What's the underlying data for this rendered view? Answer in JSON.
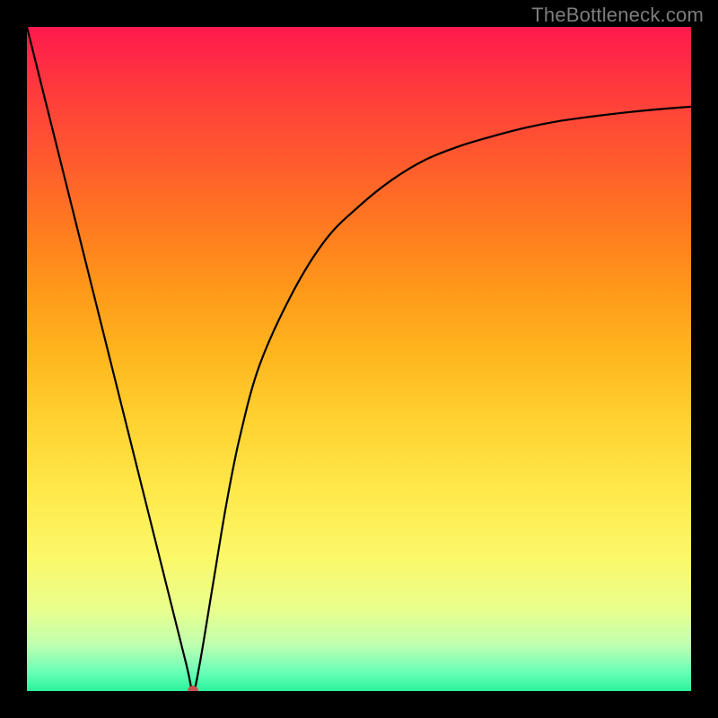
{
  "watermark": "TheBottleneck.com",
  "chart_data": {
    "type": "line",
    "title": "",
    "xlabel": "",
    "ylabel": "",
    "xlim": [
      0,
      100
    ],
    "ylim": [
      0,
      100
    ],
    "grid": false,
    "legend": false,
    "series": [
      {
        "name": "bottleneck-curve",
        "x": [
          0,
          5,
          10,
          15,
          20,
          24,
          25,
          26,
          28,
          30,
          32,
          35,
          40,
          45,
          50,
          55,
          60,
          65,
          70,
          75,
          80,
          85,
          90,
          95,
          100
        ],
        "y": [
          100,
          80,
          60,
          40,
          20,
          4,
          0,
          4,
          16,
          28,
          38,
          49,
          60,
          68,
          73,
          77,
          80,
          82,
          83.5,
          84.8,
          85.8,
          86.5,
          87.1,
          87.6,
          88
        ]
      }
    ],
    "marker": {
      "x": 25,
      "y": 0,
      "color": "#c94e4e",
      "radius_px": 6
    }
  }
}
